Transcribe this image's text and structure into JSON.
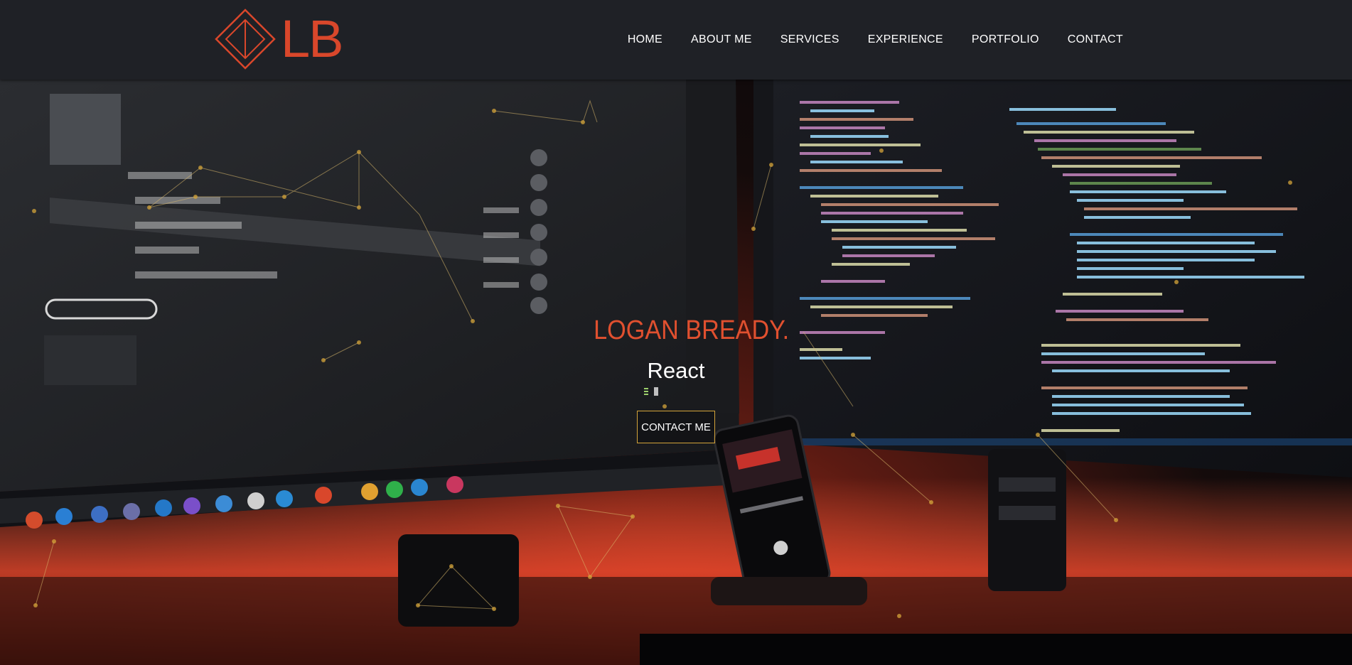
{
  "brand": {
    "logo_text": "LB",
    "accent_color": "#d9472b"
  },
  "nav": {
    "items": [
      {
        "label": "HOME"
      },
      {
        "label": "ABOUT ME"
      },
      {
        "label": "SERVICES"
      },
      {
        "label": "EXPERIENCE"
      },
      {
        "label": "PORTFOLIO"
      },
      {
        "label": "CONTACT"
      }
    ]
  },
  "hero": {
    "title": "LOGAN BREADY.",
    "subtitle": "React",
    "cta_label": "CONTACT ME",
    "cta_border_color": "#d4a43a",
    "background_description_icon": "desk-setup-photo"
  }
}
